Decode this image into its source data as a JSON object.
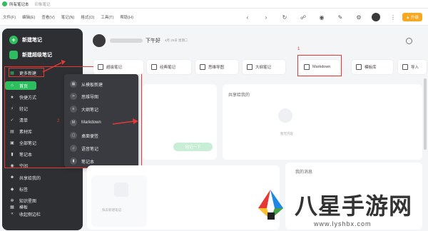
{
  "titlebar": {
    "title": "所有笔记本",
    "account": "印象笔记"
  },
  "menubar": {
    "items": [
      "文件(F)",
      "编辑(E)",
      "查看(V)",
      "笔记(N)",
      "格式(O)",
      "工具(T)",
      "帮助(H)"
    ]
  },
  "toolbar": {
    "upgrade": "升级",
    "icons": [
      "back-icon",
      "forward-icon",
      "sync-icon",
      "activity-icon",
      "radar-icon",
      "chat-icon",
      "community-icon",
      "avatar",
      "upgrade-button"
    ]
  },
  "sidebar": {
    "new_note": "新建笔记",
    "new_super_note": "新建超级笔记",
    "items": [
      {
        "label": "更多新建",
        "icon": "grid-icon"
      },
      {
        "label": "首页",
        "icon": "home-icon"
      },
      {
        "label": "快捷方式",
        "icon": "star-icon"
      },
      {
        "label": "轻记",
        "icon": "lightning-icon"
      },
      {
        "label": "清单",
        "icon": "check-icon"
      },
      {
        "label": "素材库",
        "icon": "folder-icon"
      },
      {
        "label": "全部笔记",
        "icon": "note-icon"
      },
      {
        "label": "笔记本",
        "icon": "notebook-icon"
      },
      {
        "label": "空间",
        "icon": "space-icon"
      },
      {
        "label": "共享给我的",
        "icon": "people-icon"
      },
      {
        "label": "标签",
        "icon": "tag-icon"
      },
      {
        "label": "知识星图",
        "icon": "graph-icon"
      },
      {
        "label": "模板",
        "icon": "template-icon"
      },
      {
        "label": "收起侧边栏",
        "icon": "collapse-icon"
      }
    ]
  },
  "submenu": {
    "items": [
      {
        "label": "从模板新建",
        "icon": "template-icon"
      },
      {
        "label": "思维导图",
        "icon": "mindmap-icon"
      },
      {
        "label": "大纲笔记",
        "icon": "outline-icon"
      },
      {
        "label": "Markdown",
        "icon": "markdown-icon"
      },
      {
        "label": "桌面便签",
        "icon": "sticky-icon"
      },
      {
        "label": "语音笔记",
        "icon": "mic-icon"
      },
      {
        "label": "笔记本",
        "icon": "notebook-icon"
      }
    ]
  },
  "annotations": {
    "one": "1",
    "two": "2"
  },
  "main": {
    "greeting": "下午好",
    "date": "4月 25日 星期二",
    "cards": [
      "超级笔记",
      "经典笔记",
      "思维导图",
      "大纲笔记",
      "Markdown",
      "模板库",
      "导入"
    ],
    "shared_title": "共享给我的",
    "shared_empty": "暂无内容",
    "quick_btn": "轻记一下",
    "messages_title": "我的消息",
    "quick_create": "快去新建笔记"
  },
  "watermark": {
    "text": "八星手游网",
    "url": "www.lyshbx.com"
  }
}
